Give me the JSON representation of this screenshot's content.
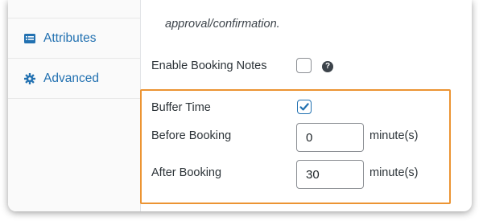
{
  "sidebar": {
    "items": [
      {
        "label": "Attributes",
        "icon": "list-table-icon"
      },
      {
        "label": "Advanced",
        "icon": "gear-icon"
      }
    ]
  },
  "main": {
    "approval_text": "approval/confirmation.",
    "enable_booking_notes": {
      "label": "Enable Booking Notes",
      "checked": false,
      "help_glyph": "?"
    },
    "buffer_time": {
      "label": "Buffer Time",
      "checked": true
    },
    "before_booking": {
      "label": "Before Booking",
      "value": "0",
      "unit": "minute(s)"
    },
    "after_booking": {
      "label": "After Booking",
      "value": "30",
      "unit": "minute(s)"
    }
  },
  "colors": {
    "link": "#2271b1",
    "highlight": "#ec9433",
    "checkbox_checked": "#2271b1"
  }
}
